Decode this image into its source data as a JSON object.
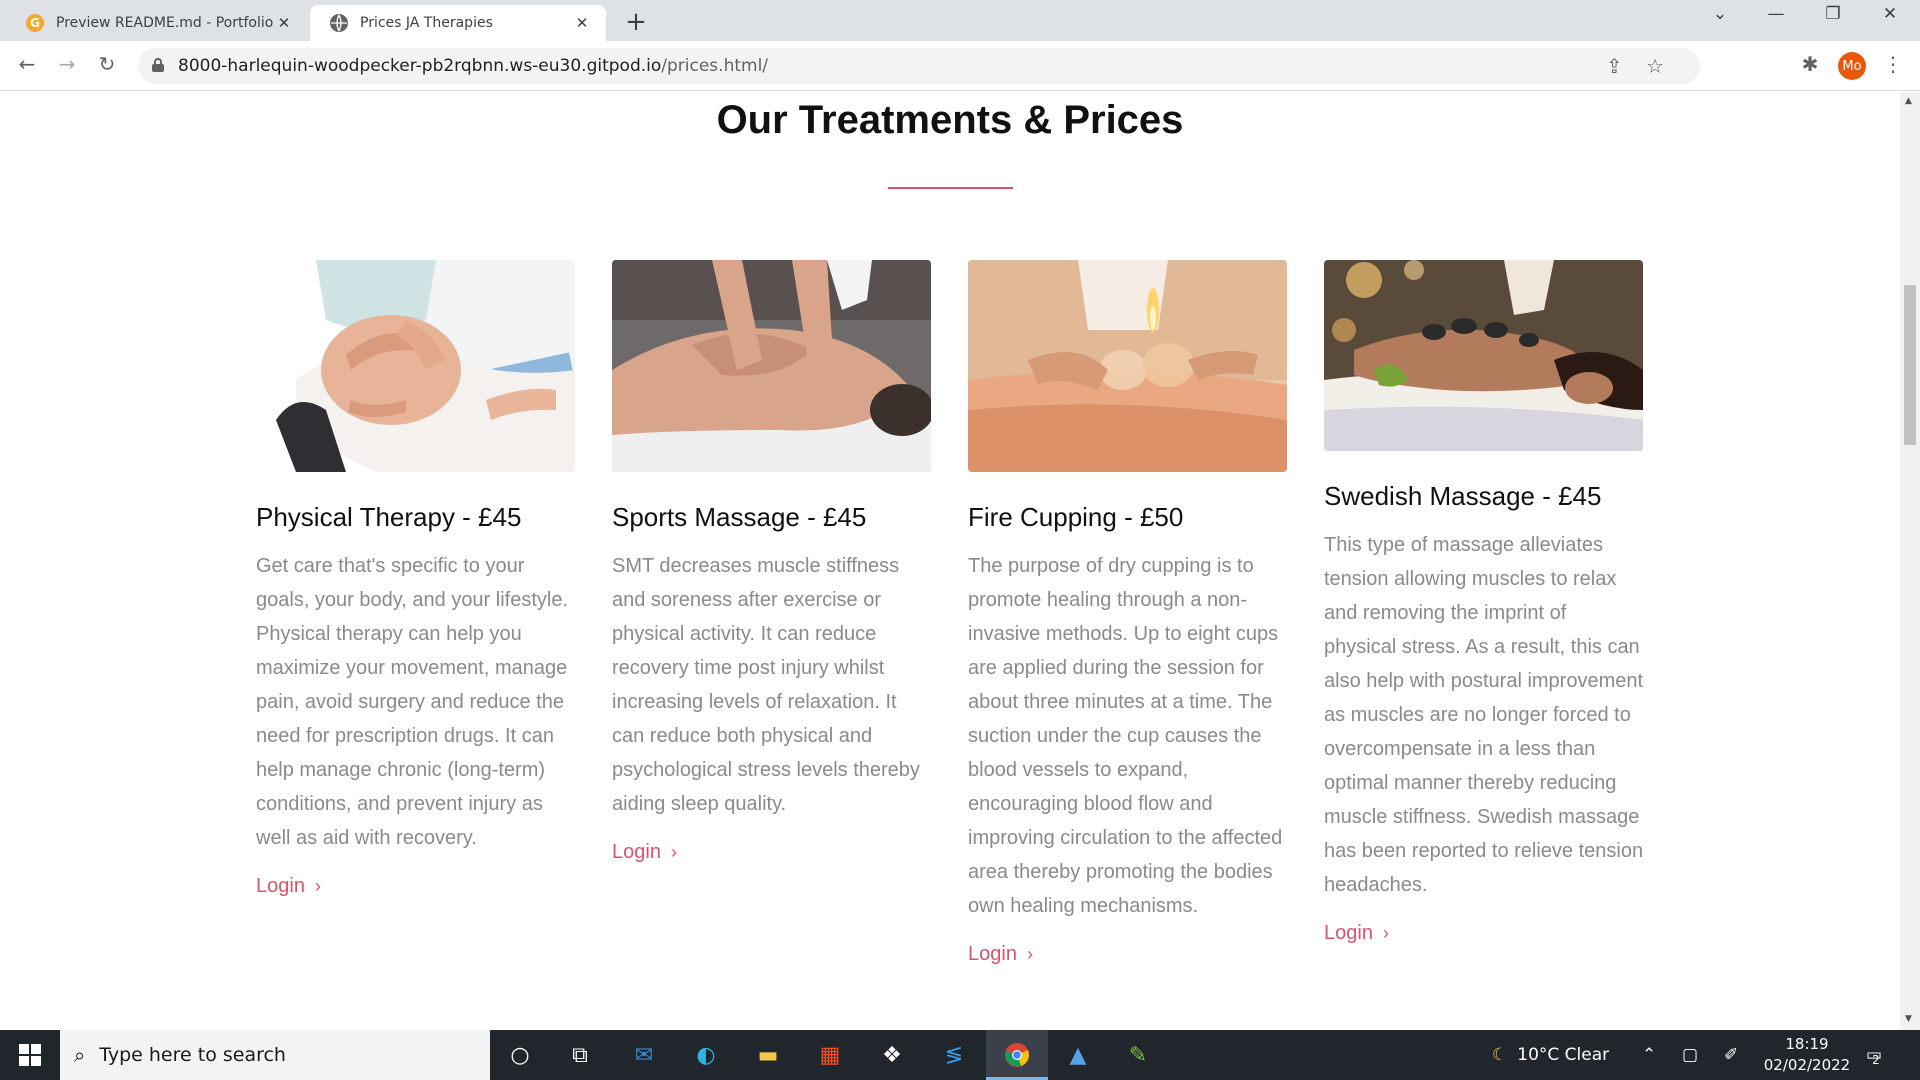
{
  "browser": {
    "tabs": [
      {
        "title": "Preview README.md - Portfolio-P",
        "favicon": "gitpod-icon"
      },
      {
        "title": "Prices JA Therapies",
        "favicon": "globe-icon"
      }
    ],
    "url_host": "8000-harlequin-woodpecker-pb2rqbnn.ws-eu30.gitpod.io",
    "url_path": "/prices.html/",
    "profile_initials": "Mo"
  },
  "page": {
    "heading": "Our Treatments & Prices",
    "accent_color": "#d6546e",
    "cards": [
      {
        "title": "Physical Therapy - £45",
        "text": "Get care that's specific to your goals, your body, and your lifestyle. Physical therapy can help you maximize your movement, manage pain, avoid surgery and reduce the need for prescription drugs. It can help manage chronic (long-term) conditions, and prevent injury as well as aid with recovery.",
        "link": "Login"
      },
      {
        "title": "Sports Massage - £45",
        "text": "SMT decreases muscle stiffness and soreness after exercise or physical activity. It can reduce recovery time post injury whilst increasing levels of relaxation. It can reduce both physical and psychological stress levels thereby aiding sleep quality.",
        "link": "Login"
      },
      {
        "title": "Fire Cupping - £50",
        "text": "The purpose of dry cupping is to promote healing through a non-invasive methods. Up to eight cups are applied during the session for about three minutes at a time. The suction under the cup causes the blood vessels to expand, encouraging blood flow and improving circulation to the affected area thereby promoting the bodies own healing mechanisms.",
        "link": "Login"
      },
      {
        "title": "Swedish Massage - £45",
        "text": "This type of massage alleviates tension allowing muscles to relax and removing the imprint of physical stress. As a result, this can also help with postural improvement as muscles are no longer forced to overcompensate in a less than optimal manner thereby reducing muscle stiffness. Swedish massage has been reported to relieve tension headaches.",
        "link": "Login"
      }
    ]
  },
  "taskbar": {
    "search_placeholder": "Type here to search",
    "weather": "10°C  Clear",
    "time": "18:19",
    "date": "02/02/2022",
    "notification_count": "2"
  }
}
